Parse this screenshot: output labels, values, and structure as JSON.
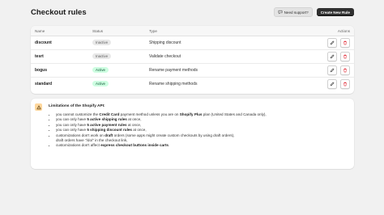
{
  "page": {
    "title": "Checkout rules"
  },
  "header": {
    "support_label": "Need support?",
    "create_label": "Create New Rule"
  },
  "table": {
    "columns": {
      "name": "Name",
      "status": "Status",
      "type": "Type",
      "actions": "Actions"
    },
    "rows": [
      {
        "name": "discount",
        "status": "Inactive",
        "type": "Shipping discount"
      },
      {
        "name": "tesrt",
        "status": "Inactive",
        "type": "Validate checkout"
      },
      {
        "name": "bogus",
        "status": "Active",
        "type": "Rename payment methods"
      },
      {
        "name": "standard",
        "status": "Active",
        "type": "Rename shipping methods"
      }
    ]
  },
  "notice": {
    "title": "Limitations of the Shopify API:",
    "items": [
      {
        "a": "you cannot customize the ",
        "b": "Credit Card",
        "c": " payment method unless you are on ",
        "d": "Shopify Plus",
        "e": " plan (United States and Canada only),"
      },
      {
        "a": "you can only have ",
        "b": "5 active shipping rules",
        "c": " at once,"
      },
      {
        "a": "you can only have ",
        "b": "5 active payment rules",
        "c": " at once,"
      },
      {
        "a": "you can only have ",
        "b": "5 shipping discount rules",
        "c": " at once,"
      },
      {
        "a": "customizations don't work on ",
        "b": "draft",
        "c": " orders (some apps might create custom checkouts by using draft orders),",
        "d": "draft orders have \"/do/\" in the checkout link,"
      },
      {
        "a": "customizations don't affect ",
        "b": "express checkout buttons inside carts",
        "c": "."
      }
    ]
  },
  "colors": {
    "active_badge_bg": "#cdfee1",
    "inactive_badge_bg": "#e8e8e8",
    "delete_icon": "#e22c38",
    "warning_bg": "#ffd79d"
  }
}
